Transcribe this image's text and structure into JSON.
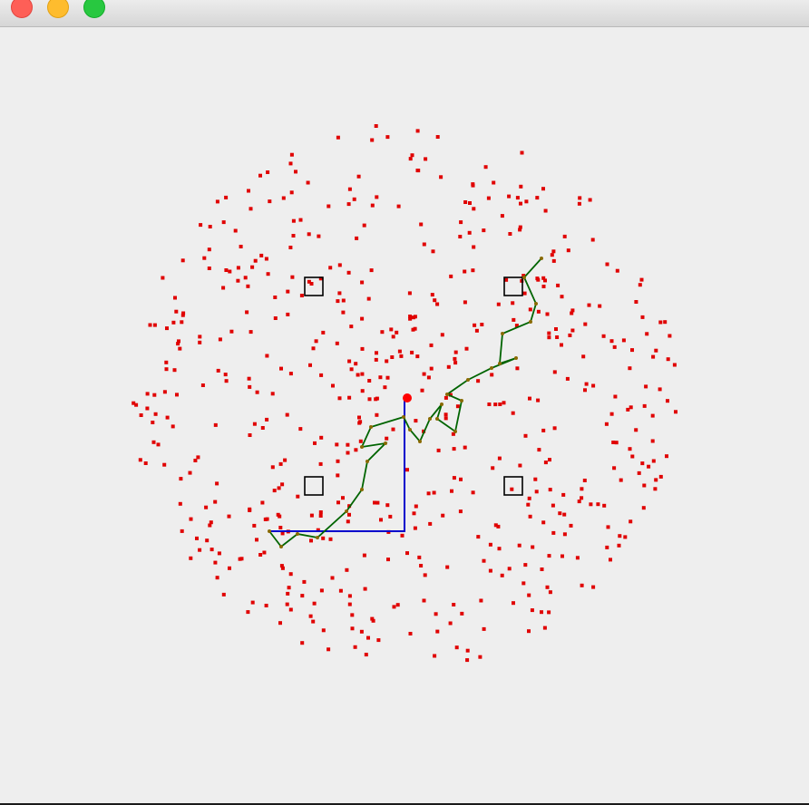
{
  "window": {
    "title": "",
    "controls": [
      "close",
      "minimize",
      "zoom"
    ],
    "control_colors": {
      "close": "#fe5f57",
      "minimize": "#febc2e",
      "zoom": "#28c840"
    }
  },
  "simulation": {
    "background": "#eeeeee",
    "point_color": "#e00000",
    "agent_path_color": "#006400",
    "planned_path_color": "#0000cc",
    "target_box_color": "#000000",
    "target_count": 4,
    "cloud_point_count": 520,
    "origin_marker_color": "#ff0000"
  }
}
